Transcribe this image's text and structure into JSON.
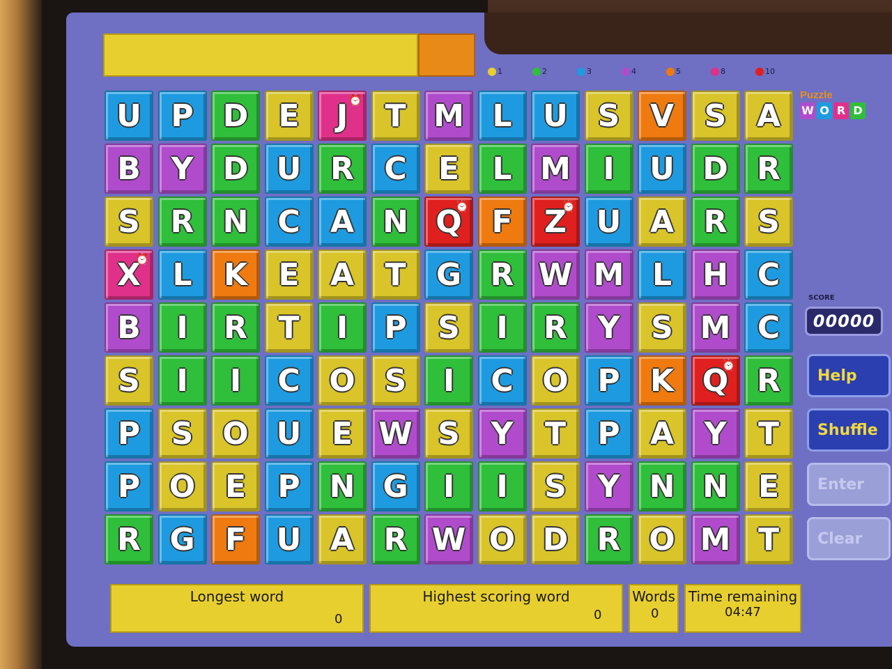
{
  "legend": [
    {
      "value": "1",
      "color": "#e8cf30"
    },
    {
      "value": "2",
      "color": "#2fbf3a"
    },
    {
      "value": "3",
      "color": "#1e9be0"
    },
    {
      "value": "4",
      "color": "#b04ccc"
    },
    {
      "value": "5",
      "color": "#ee7a10"
    },
    {
      "value": "8",
      "color": "#e0318a"
    },
    {
      "value": "10",
      "color": "#e0201e"
    }
  ],
  "logo": {
    "top": "Puzzle",
    "letters": [
      "W",
      "O",
      "R",
      "D"
    ]
  },
  "grid": {
    "rows": [
      [
        [
          "U",
          "blue",
          false
        ],
        [
          "P",
          "blue",
          false
        ],
        [
          "D",
          "green",
          false
        ],
        [
          "E",
          "yellow",
          false
        ],
        [
          "J",
          "pink",
          true
        ],
        [
          "T",
          "yellow",
          false
        ],
        [
          "M",
          "purple",
          false
        ],
        [
          "L",
          "blue",
          false
        ],
        [
          "U",
          "blue",
          false
        ],
        [
          "S",
          "yellow",
          false
        ],
        [
          "V",
          "orange",
          false
        ],
        [
          "S",
          "yellow",
          false
        ],
        [
          "A",
          "yellow",
          false
        ]
      ],
      [
        [
          "B",
          "purple",
          false
        ],
        [
          "Y",
          "purple",
          false
        ],
        [
          "D",
          "green",
          false
        ],
        [
          "U",
          "blue",
          false
        ],
        [
          "R",
          "green",
          false
        ],
        [
          "C",
          "blue",
          false
        ],
        [
          "E",
          "yellow",
          false
        ],
        [
          "L",
          "green",
          false
        ],
        [
          "M",
          "purple",
          false
        ],
        [
          "I",
          "green",
          false
        ],
        [
          "U",
          "blue",
          false
        ],
        [
          "D",
          "green",
          false
        ],
        [
          "R",
          "green",
          false
        ]
      ],
      [
        [
          "S",
          "yellow",
          false
        ],
        [
          "R",
          "green",
          false
        ],
        [
          "N",
          "green",
          false
        ],
        [
          "C",
          "blue",
          false
        ],
        [
          "A",
          "blue",
          false
        ],
        [
          "N",
          "green",
          false
        ],
        [
          "Q",
          "red",
          true
        ],
        [
          "F",
          "orange",
          false
        ],
        [
          "Z",
          "red",
          true
        ],
        [
          "U",
          "blue",
          false
        ],
        [
          "A",
          "yellow",
          false
        ],
        [
          "R",
          "green",
          false
        ],
        [
          "S",
          "yellow",
          false
        ]
      ],
      [
        [
          "X",
          "pink",
          true
        ],
        [
          "L",
          "blue",
          false
        ],
        [
          "K",
          "orange",
          false
        ],
        [
          "E",
          "yellow",
          false
        ],
        [
          "A",
          "yellow",
          false
        ],
        [
          "T",
          "yellow",
          false
        ],
        [
          "G",
          "blue",
          false
        ],
        [
          "R",
          "green",
          false
        ],
        [
          "W",
          "purple",
          false
        ],
        [
          "M",
          "purple",
          false
        ],
        [
          "L",
          "blue",
          false
        ],
        [
          "H",
          "purple",
          false
        ],
        [
          "C",
          "blue",
          false
        ]
      ],
      [
        [
          "B",
          "purple",
          false
        ],
        [
          "I",
          "green",
          false
        ],
        [
          "R",
          "green",
          false
        ],
        [
          "T",
          "yellow",
          false
        ],
        [
          "I",
          "green",
          false
        ],
        [
          "P",
          "blue",
          false
        ],
        [
          "S",
          "yellow",
          false
        ],
        [
          "I",
          "green",
          false
        ],
        [
          "R",
          "green",
          false
        ],
        [
          "Y",
          "purple",
          false
        ],
        [
          "S",
          "yellow",
          false
        ],
        [
          "M",
          "purple",
          false
        ],
        [
          "C",
          "blue",
          false
        ]
      ],
      [
        [
          "S",
          "yellow",
          false
        ],
        [
          "I",
          "green",
          false
        ],
        [
          "I",
          "green",
          false
        ],
        [
          "C",
          "blue",
          false
        ],
        [
          "O",
          "yellow",
          false
        ],
        [
          "S",
          "yellow",
          false
        ],
        [
          "I",
          "green",
          false
        ],
        [
          "C",
          "blue",
          false
        ],
        [
          "O",
          "yellow",
          false
        ],
        [
          "P",
          "blue",
          false
        ],
        [
          "K",
          "orange",
          false
        ],
        [
          "Q",
          "red",
          true
        ],
        [
          "R",
          "green",
          false
        ]
      ],
      [
        [
          "P",
          "blue",
          false
        ],
        [
          "S",
          "yellow",
          false
        ],
        [
          "O",
          "yellow",
          false
        ],
        [
          "U",
          "blue",
          false
        ],
        [
          "E",
          "yellow",
          false
        ],
        [
          "W",
          "purple",
          false
        ],
        [
          "S",
          "yellow",
          false
        ],
        [
          "Y",
          "purple",
          false
        ],
        [
          "T",
          "yellow",
          false
        ],
        [
          "P",
          "blue",
          false
        ],
        [
          "A",
          "yellow",
          false
        ],
        [
          "Y",
          "purple",
          false
        ],
        [
          "T",
          "yellow",
          false
        ]
      ],
      [
        [
          "P",
          "blue",
          false
        ],
        [
          "O",
          "yellow",
          false
        ],
        [
          "E",
          "yellow",
          false
        ],
        [
          "P",
          "blue",
          false
        ],
        [
          "N",
          "green",
          false
        ],
        [
          "G",
          "blue",
          false
        ],
        [
          "I",
          "green",
          false
        ],
        [
          "I",
          "green",
          false
        ],
        [
          "S",
          "yellow",
          false
        ],
        [
          "Y",
          "purple",
          false
        ],
        [
          "N",
          "green",
          false
        ],
        [
          "N",
          "green",
          false
        ],
        [
          "E",
          "yellow",
          false
        ]
      ],
      [
        [
          "R",
          "green",
          false
        ],
        [
          "G",
          "blue",
          false
        ],
        [
          "F",
          "orange",
          false
        ],
        [
          "U",
          "blue",
          false
        ],
        [
          "A",
          "yellow",
          false
        ],
        [
          "R",
          "green",
          false
        ],
        [
          "W",
          "purple",
          false
        ],
        [
          "O",
          "yellow",
          false
        ],
        [
          "D",
          "yellow",
          false
        ],
        [
          "R",
          "green",
          false
        ],
        [
          "O",
          "yellow",
          false
        ],
        [
          "M",
          "purple",
          false
        ],
        [
          "T",
          "yellow",
          false
        ]
      ]
    ]
  },
  "colors": {
    "blue": "#1e9be0",
    "green": "#2fbf3a",
    "yellow": "#d9c42a",
    "purple": "#b04ccc",
    "orange": "#ee7a10",
    "pink": "#e0318a",
    "red": "#e0201e"
  },
  "score": {
    "label": "SCORE",
    "value": "00000"
  },
  "buttons": {
    "help": "Help",
    "shuffle": "Shuffle",
    "enter": "Enter",
    "clear": "Clear"
  },
  "stats": {
    "longest_label": "Longest word",
    "longest_value": "0",
    "highest_label": "Highest scoring word",
    "highest_value": "0",
    "words_label": "Words",
    "words_value": "0",
    "time_label": "Time remaining",
    "time_value": "04:47"
  }
}
